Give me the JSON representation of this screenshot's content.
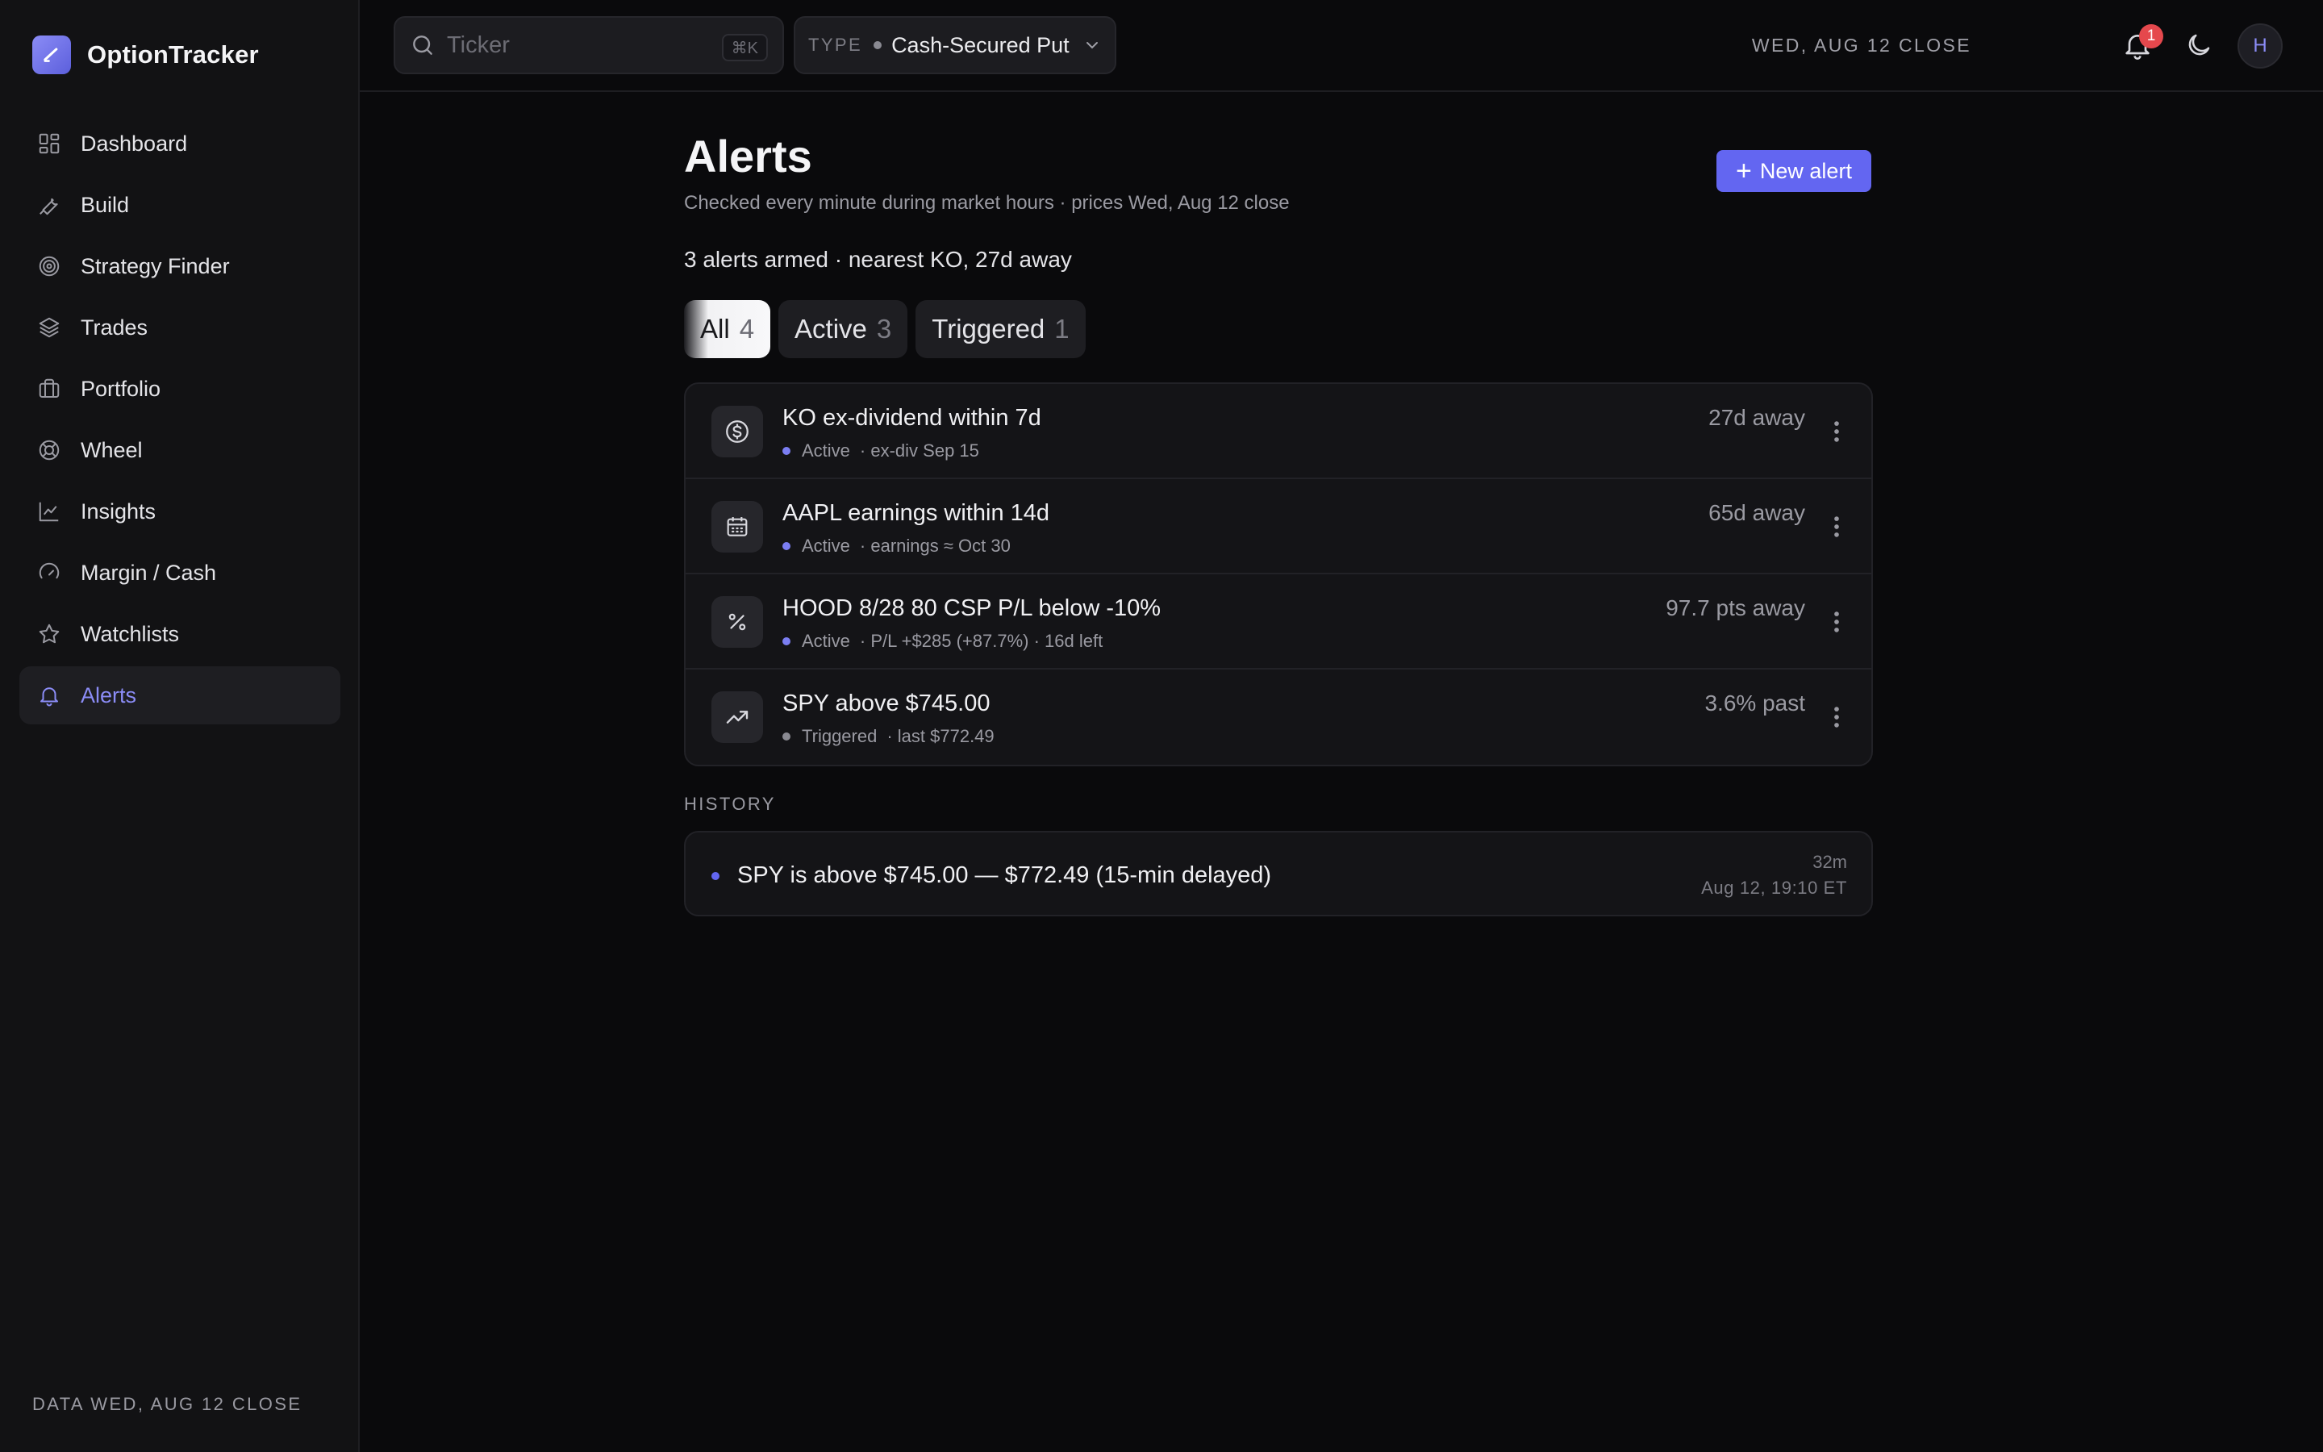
{
  "app": {
    "name": "OptionTracker"
  },
  "sidebar": {
    "items": [
      {
        "label": "Dashboard",
        "icon": "dashboard-icon"
      },
      {
        "label": "Build",
        "icon": "wrench-icon"
      },
      {
        "label": "Strategy Finder",
        "icon": "target-icon"
      },
      {
        "label": "Trades",
        "icon": "layers-icon"
      },
      {
        "label": "Portfolio",
        "icon": "briefcase-icon"
      },
      {
        "label": "Wheel",
        "icon": "lifebuoy-icon"
      },
      {
        "label": "Insights",
        "icon": "line-chart-icon"
      },
      {
        "label": "Margin / Cash",
        "icon": "gauge-icon"
      },
      {
        "label": "Watchlists",
        "icon": "star-icon"
      },
      {
        "label": "Alerts",
        "icon": "bell-icon",
        "active": true
      }
    ],
    "footer": "DATA WED, AUG 12 CLOSE"
  },
  "topbar": {
    "search": {
      "placeholder": "Ticker",
      "shortcut": "⌘K"
    },
    "type": {
      "label": "TYPE",
      "value": "Cash-Secured Put"
    },
    "close_label": "WED, AUG 12 CLOSE",
    "notifications": "1",
    "avatar": "H"
  },
  "page": {
    "title": "Alerts",
    "subtitle": "Checked every minute during market hours · prices Wed, Aug 12 close",
    "new_alert": "New alert",
    "summary": "3 alerts armed · nearest KO, 27d away",
    "tabs": [
      {
        "label": "All",
        "count": "4",
        "active": true
      },
      {
        "label": "Active",
        "count": "3"
      },
      {
        "label": "Triggered",
        "count": "1"
      }
    ],
    "alerts": [
      {
        "icon": "dollar-circle-icon",
        "title": "KO ex-dividend within 7d",
        "status": "Active",
        "detail": "· ex-div Sep 15",
        "distance": "27d away"
      },
      {
        "icon": "calendar-icon",
        "title": "AAPL earnings within 14d",
        "status": "Active",
        "detail": "· earnings ≈ Oct 30",
        "distance": "65d away"
      },
      {
        "icon": "percent-icon",
        "title": "HOOD 8/28 80 CSP P/L below -10%",
        "status": "Active",
        "detail": "· P/L +$285 (+87.7%) · 16d left",
        "distance": "97.7 pts away"
      },
      {
        "icon": "trending-up-icon",
        "title": "SPY above $745.00",
        "status": "Triggered",
        "detail": "· last $772.49",
        "distance": "3.6% past"
      }
    ],
    "history_label": "HISTORY",
    "history": [
      {
        "text": "SPY is above $745.00 — $772.49 (15-min delayed)",
        "ago": "32m",
        "when": "Aug 12, 19:10 ET"
      }
    ]
  },
  "colors": {
    "accent": "#6366f1",
    "active_dot": "#7b7ef2",
    "triggered_dot": "#8a8a92",
    "badge": "#e5484d"
  }
}
